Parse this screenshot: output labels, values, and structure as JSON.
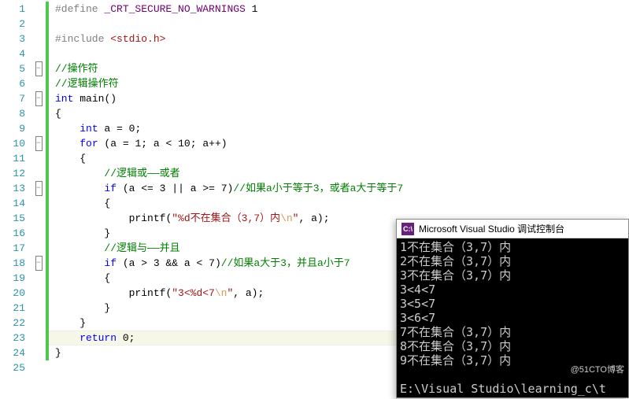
{
  "editor": {
    "max_line": 25,
    "cursor_line": 23,
    "lines": [
      {
        "n": 1,
        "bar": true,
        "fold": "",
        "html": "<span class='pp'>#define</span> <span class='macro'>_CRT_SECURE_NO_WARNINGS</span> <span class='num'>1</span>"
      },
      {
        "n": 2,
        "bar": true,
        "fold": "",
        "html": ""
      },
      {
        "n": 3,
        "bar": true,
        "fold": "",
        "html": "<span class='pp'>#include</span> <span class='str'>&lt;stdio.h&gt;</span>"
      },
      {
        "n": 4,
        "bar": true,
        "fold": "",
        "html": ""
      },
      {
        "n": 5,
        "bar": true,
        "fold": "minus",
        "html": "<span class='cmt'>//操作符</span>"
      },
      {
        "n": 6,
        "bar": true,
        "fold": "",
        "html": "<span class='cmt'>//逻辑操作符</span>"
      },
      {
        "n": 7,
        "bar": true,
        "fold": "minus",
        "html": "<span class='kw'>int</span> <span class='fn'>main</span>()"
      },
      {
        "n": 8,
        "bar": true,
        "fold": "",
        "html": "{"
      },
      {
        "n": 9,
        "bar": true,
        "fold": "",
        "html": "    <span class='kw'>int</span> a <span class='op'>=</span> <span class='num'>0</span>;"
      },
      {
        "n": 10,
        "bar": true,
        "fold": "minus",
        "html": "    <span class='kw'>for</span> (a <span class='op'>=</span> <span class='num'>1</span>; a <span class='op'>&lt;</span> <span class='num'>10</span>; a<span class='op'>++</span>)"
      },
      {
        "n": 11,
        "bar": true,
        "fold": "",
        "html": "    {"
      },
      {
        "n": 12,
        "bar": true,
        "fold": "",
        "html": "        <span class='cmt'>//逻辑或——或者</span>"
      },
      {
        "n": 13,
        "bar": true,
        "fold": "minus",
        "html": "        <span class='kw'>if</span> (a <span class='op'>&lt;=</span> <span class='num'>3</span> <span class='op'>||</span> a <span class='op'>&gt;=</span> <span class='num'>7</span>)<span class='cmt'>//如果a小于等于3，或者a大于等于7</span>"
      },
      {
        "n": 14,
        "bar": true,
        "fold": "",
        "html": "        {"
      },
      {
        "n": 15,
        "bar": true,
        "fold": "",
        "html": "            <span class='fn'>printf</span>(<span class='str'>\"%d不在集合（3,7）内</span><span class='esc'>\\n</span><span class='str'>\"</span>, a);"
      },
      {
        "n": 16,
        "bar": true,
        "fold": "",
        "html": "        }"
      },
      {
        "n": 17,
        "bar": true,
        "fold": "",
        "html": "        <span class='cmt'>//逻辑与——并且</span>"
      },
      {
        "n": 18,
        "bar": true,
        "fold": "minus",
        "html": "        <span class='kw'>if</span> (a <span class='op'>&gt;</span> <span class='num'>3</span> <span class='op'>&amp;&amp;</span> a <span class='op'>&lt;</span> <span class='num'>7</span>)<span class='cmt'>//如果a大于3，并且a小于7</span>"
      },
      {
        "n": 19,
        "bar": true,
        "fold": "",
        "html": "        {"
      },
      {
        "n": 20,
        "bar": true,
        "fold": "",
        "html": "            <span class='fn'>printf</span>(<span class='str'>\"3&lt;%d&lt;7</span><span class='esc'>\\n</span><span class='str'>\"</span>, a);"
      },
      {
        "n": 21,
        "bar": true,
        "fold": "",
        "html": "        }"
      },
      {
        "n": 22,
        "bar": true,
        "fold": "",
        "html": "    }"
      },
      {
        "n": 23,
        "bar": true,
        "fold": "",
        "html": "    <span class='kw'>return</span> <span class='num'>0</span>;"
      },
      {
        "n": 24,
        "bar": true,
        "fold": "",
        "html": "}"
      },
      {
        "n": 25,
        "bar": false,
        "fold": "",
        "html": ""
      }
    ]
  },
  "console": {
    "title": "Microsoft Visual Studio 调试控制台",
    "icon_text": "C:\\",
    "output": "1不在集合（3,7）内\n2不在集合（3,7）内\n3不在集合（3,7）内\n3<4<7\n3<5<7\n3<6<7\n7不在集合（3,7）内\n8不在集合（3,7）内\n9不在集合（3,7）内\n\nE:\\Visual Studio\\learning_c\\t"
  },
  "watermark": "@51CTO博客"
}
